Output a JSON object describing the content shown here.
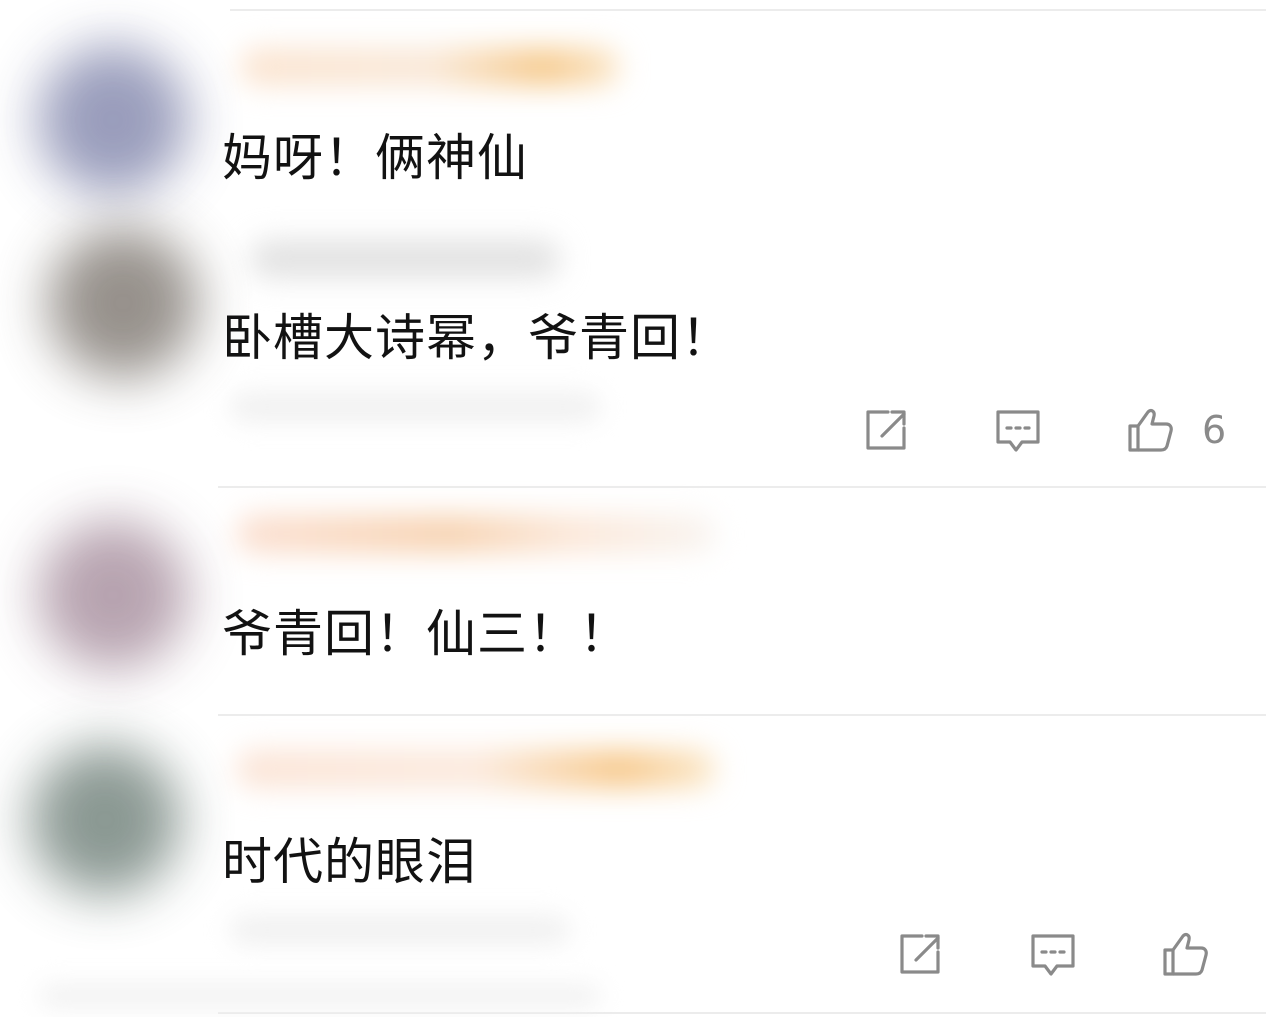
{
  "comments": [
    {
      "text": "妈呀！俩神仙",
      "avatar_color": "#8f93b5",
      "name_color": "#f6c98b"
    },
    {
      "text": "卧槽大诗幂，爷青回！",
      "avatar_color": "#8c8680",
      "name_color": "#dcdcdc",
      "like_count": "6"
    },
    {
      "text": "爷青回！仙三！！",
      "avatar_color": "#b09aa8",
      "name_color": "#f5cfa6"
    },
    {
      "text": "时代的眼泪",
      "avatar_color": "#7f8e88",
      "name_color": "#f7c88a"
    }
  ],
  "icons": {
    "share": "share-icon",
    "reply": "reply-icon",
    "like": "thumbs-up-icon"
  },
  "colors": {
    "icon_gray": "#8a8a8a",
    "divider": "#ececec",
    "text": "#121212"
  }
}
